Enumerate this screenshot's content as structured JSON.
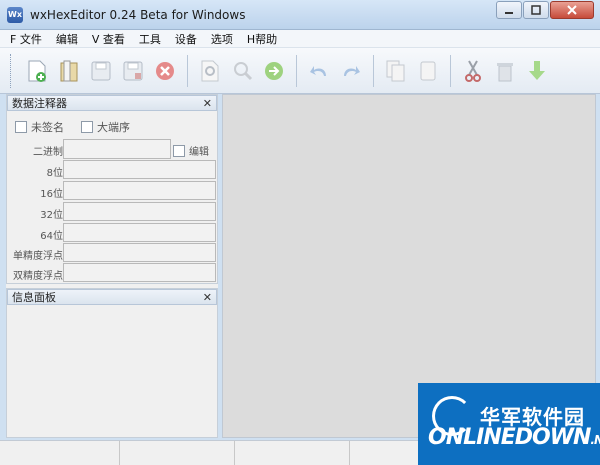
{
  "window": {
    "title": "wxHexEditor 0.24 Beta for Windows",
    "icon_text": "Wx"
  },
  "menu": [
    "F 文件",
    "编辑",
    "V 查看",
    "工具",
    "设备",
    "选项",
    "H帮助"
  ],
  "toolbar": {
    "buttons": [
      "new-file-icon",
      "open-file-icon",
      "save-icon",
      "save-as-icon",
      "close-file-icon",
      "find-icon",
      "replace-icon",
      "goto-icon",
      "undo-icon",
      "redo-icon",
      "copy-icon",
      "paste-icon",
      "cut-icon",
      "delete-icon",
      "insert-icon"
    ]
  },
  "interpreter": {
    "title": "数据注释器",
    "unsigned_label": "未签名",
    "big_endian_label": "大端序",
    "binary_label": "二进制",
    "edit_label": "编辑",
    "fields": [
      "8位",
      "16位",
      "32位",
      "64位",
      "单精度浮点",
      "双精度浮点"
    ]
  },
  "info_panel": {
    "title": "信息面板"
  },
  "watermark": {
    "chinese": "华军软件园",
    "english": "ONLINEDOWN",
    "suffix": ".NET"
  }
}
